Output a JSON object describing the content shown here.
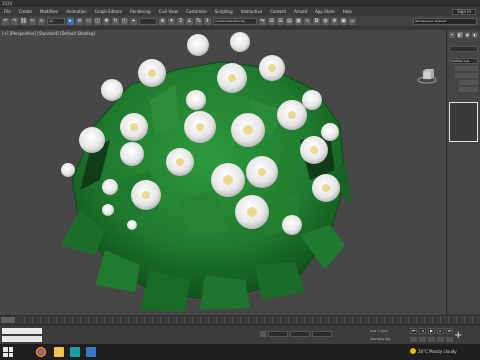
{
  "window": {
    "title": "2020"
  },
  "menu": {
    "items": [
      "File",
      "Create",
      "Modifiers",
      "Animation",
      "Graph Editors",
      "Rendering",
      "Civil View",
      "Customize",
      "Scripting",
      "Interactive",
      "Content",
      "Arnold",
      "App Store",
      "Help"
    ],
    "sign_in": "Sign In"
  },
  "toolbar": {
    "filter_value": "All",
    "selection_set": "Create Selection Se",
    "workspace": "Workspaces: Default"
  },
  "viewport": {
    "label": "[+] [Perspective] [Standard] [Default Shading]"
  },
  "command_panel": {
    "tabs": [
      "+",
      "◧",
      "◉",
      "◐",
      "▭",
      "⚙"
    ],
    "modifier_list_label": "Modifier List"
  },
  "status": {
    "grid_text": "Grid = 10.0",
    "add_time_tag": "Add Time Tag"
  },
  "taskbar": {
    "weather_temp": "26°C",
    "weather_text": "Mostly cloudy"
  },
  "colors": {
    "leaf": "#1f7a2e",
    "leaf_dark": "#0f4d1a",
    "flower": "#ececec",
    "flower_center": "#e8d27a",
    "viewport_bg": "#474747"
  }
}
